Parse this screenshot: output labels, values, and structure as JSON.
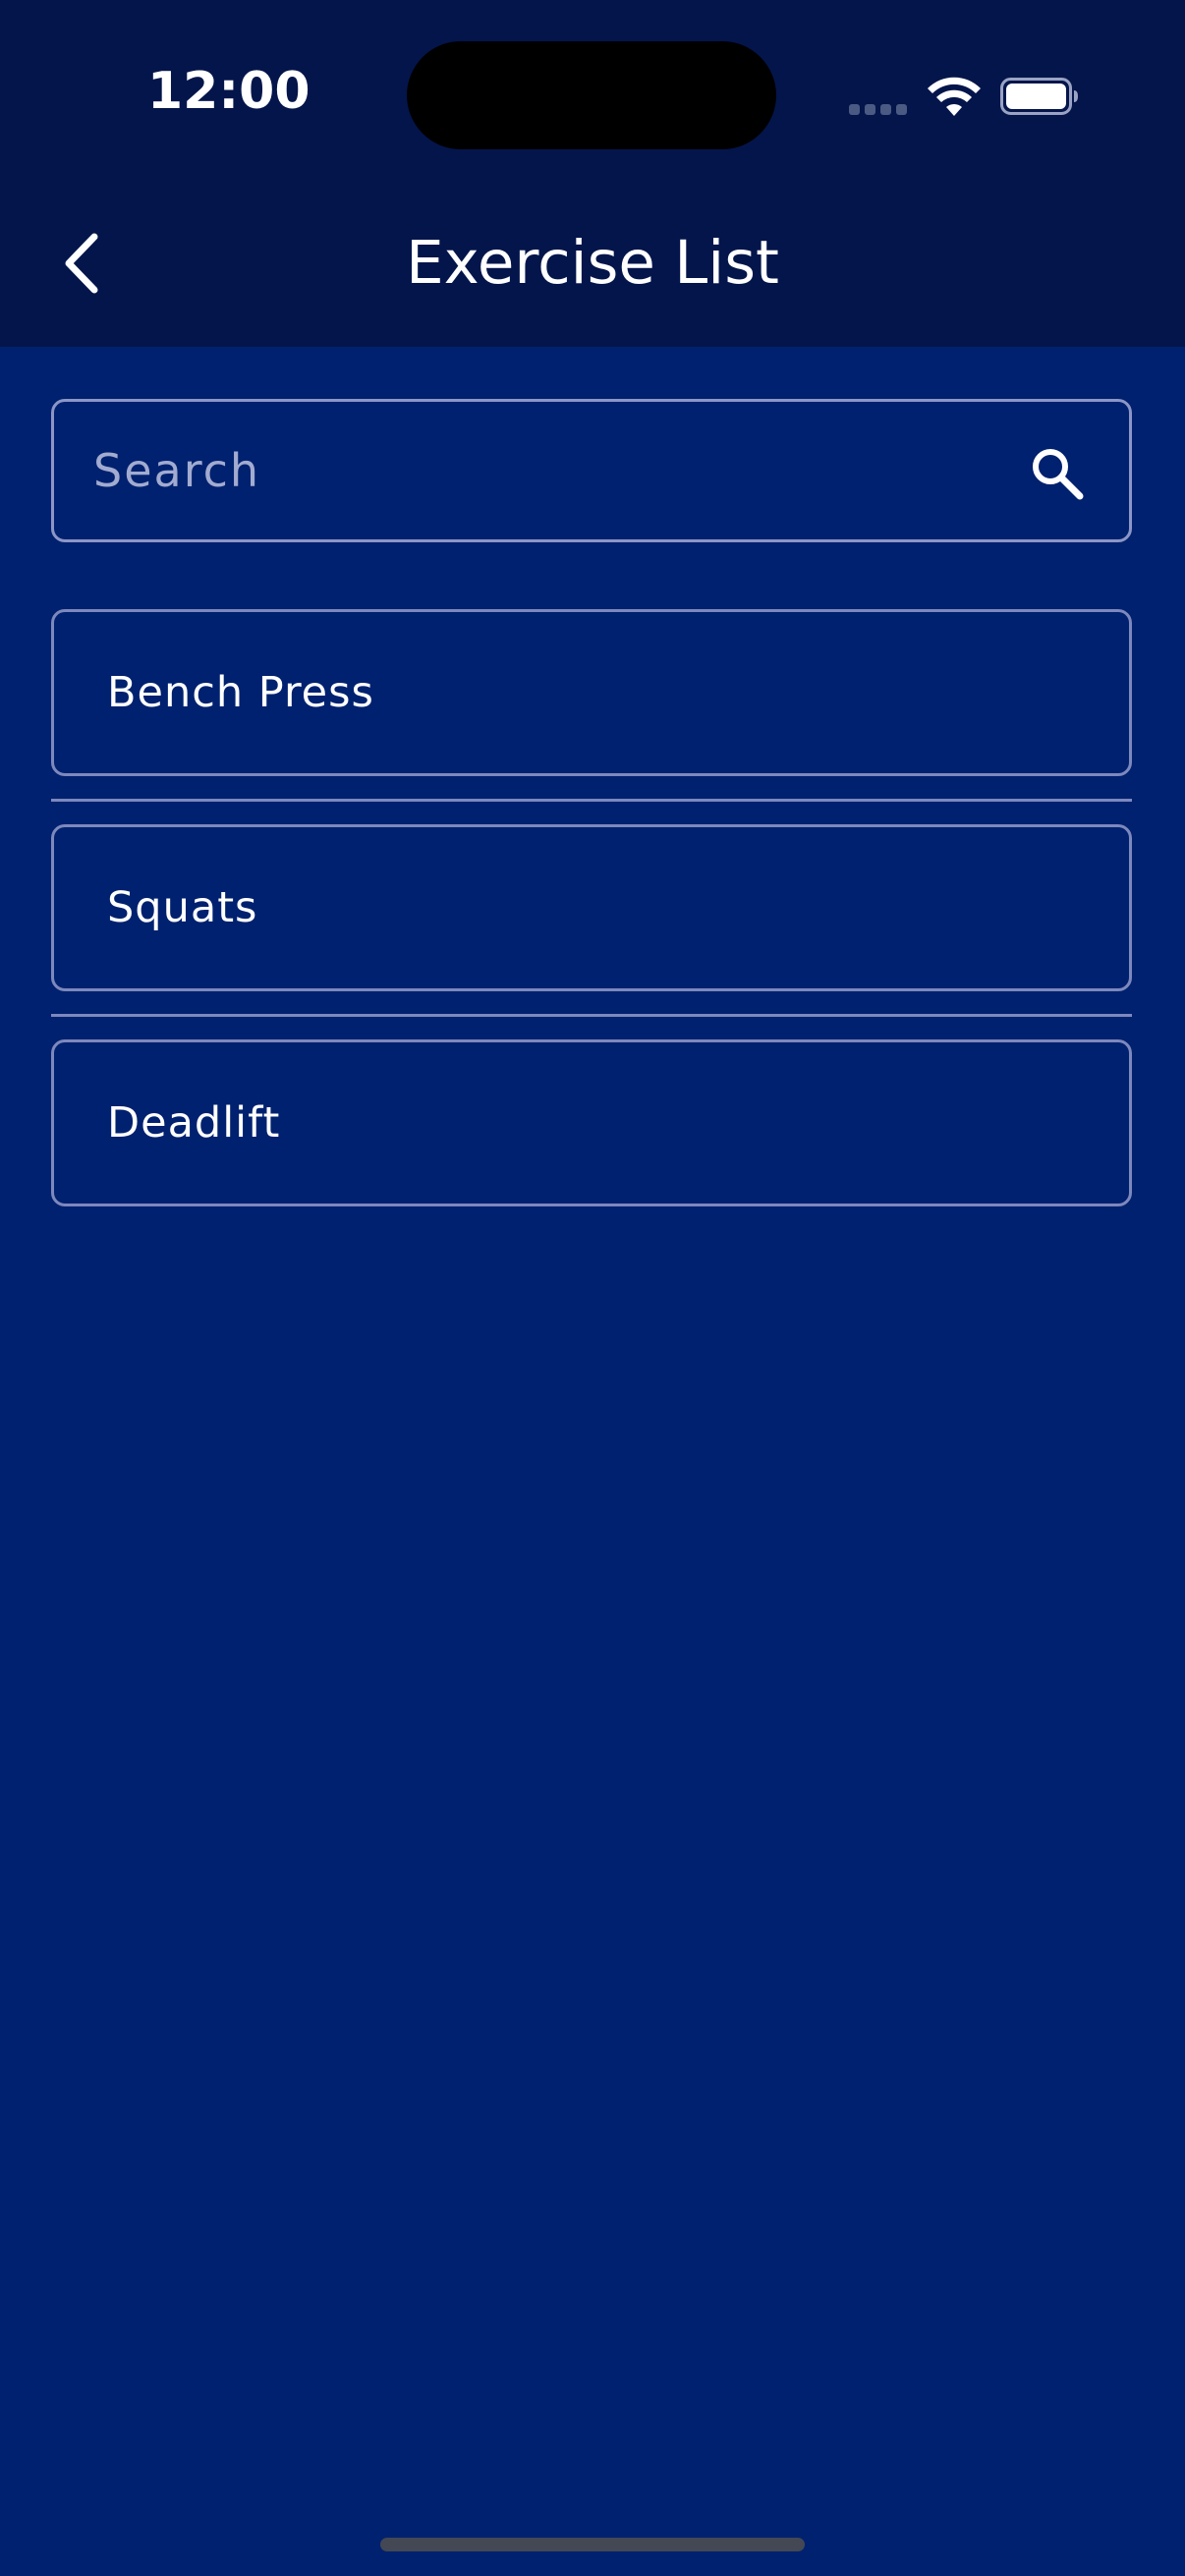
{
  "status_bar": {
    "time": "12:00"
  },
  "header": {
    "title": "Exercise List",
    "back_icon": "chevron-left-icon"
  },
  "search": {
    "placeholder": "Search",
    "value": "",
    "icon": "search-icon"
  },
  "exercises": [
    {
      "label": "Bench Press"
    },
    {
      "label": "Squats"
    },
    {
      "label": "Deadlift"
    }
  ],
  "colors": {
    "header_bg": "#04154b",
    "page_bg": "#00216f",
    "border": "#8c96c6",
    "text": "#ffffff",
    "placeholder": "#a2abd0"
  }
}
